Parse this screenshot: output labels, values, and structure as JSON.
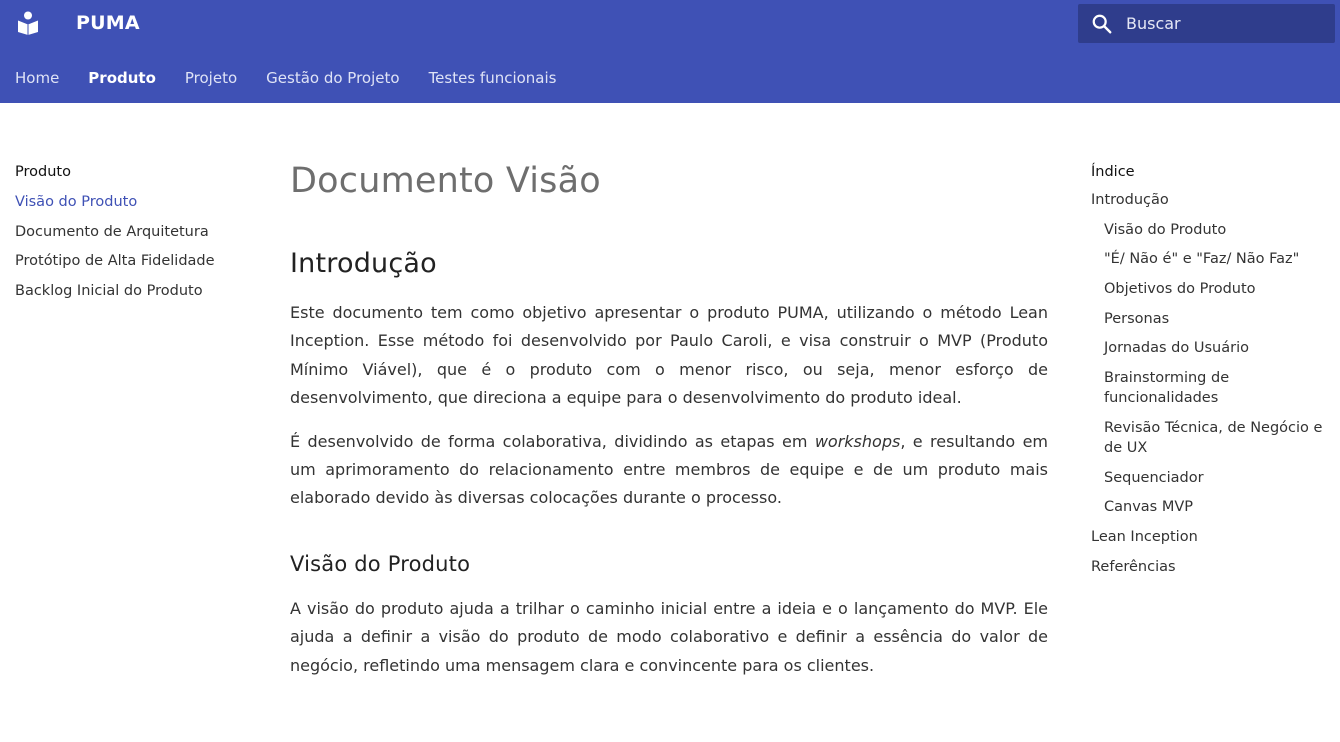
{
  "header": {
    "title": "PUMA",
    "logo_icon": "book-reader-icon",
    "search_placeholder": "Buscar",
    "tabs": [
      {
        "label": "Home"
      },
      {
        "label": "Produto"
      },
      {
        "label": "Projeto"
      },
      {
        "label": "Gestão do Projeto"
      },
      {
        "label": "Testes funcionais"
      }
    ],
    "active_tab": "Produto",
    "bg_color": "#3f51b5"
  },
  "left_nav": {
    "title": "Produto",
    "items": [
      {
        "label": "Visão do Produto"
      },
      {
        "label": "Documento de Arquitetura"
      },
      {
        "label": "Protótipo de Alta Fidelidade"
      },
      {
        "label": "Backlog Inicial do Produto"
      }
    ],
    "active_item": "Visão do Produto"
  },
  "content": {
    "title": "Documento Visão",
    "sections": [
      {
        "heading": "Introdução",
        "p1": "Este documento tem como objetivo apresentar o produto PUMA, utilizando o método Lean Inception. Esse método foi desenvolvido por Paulo Caroli, e visa construir o MVP (Produto Mínimo Viável), que é o produto com o menor risco, ou seja, menor esforço de desenvolvimento, que direciona a equipe para o desenvolvimento do produto ideal.",
        "p2_before": "É desenvolvido de forma colaborativa, dividindo as etapas em ",
        "p2_em": "workshops",
        "p2_after": ", e resultando em um aprimoramento do relacionamento entre membros de equipe e de um produto mais elaborado devido às diversas colocações durante o processo."
      },
      {
        "heading": "Visão do Produto",
        "p1": "A visão do produto ajuda a trilhar o caminho inicial entre a ideia e o lançamento do MVP. Ele ajuda a definir a visão do produto de modo colaborativo e definir a essência do valor de negócio, refletindo uma mensagem clara e convincente para os clientes."
      }
    ]
  },
  "toc": {
    "title": "Índice",
    "items": [
      {
        "label": "Introdução"
      },
      {
        "label": "Visão do Produto"
      },
      {
        "label": "\"É/ Não é\" e \"Faz/ Não Faz\""
      },
      {
        "label": "Objetivos do Produto"
      },
      {
        "label": "Personas"
      },
      {
        "label": "Jornadas do Usuário"
      },
      {
        "label": "Brainstorming de funcionalidades"
      },
      {
        "label": "Revisão Técnica, de Negócio e de UX"
      },
      {
        "label": "Sequenciador"
      },
      {
        "label": "Canvas MVP"
      },
      {
        "label": "Lean Inception"
      },
      {
        "label": "Referências"
      }
    ]
  }
}
